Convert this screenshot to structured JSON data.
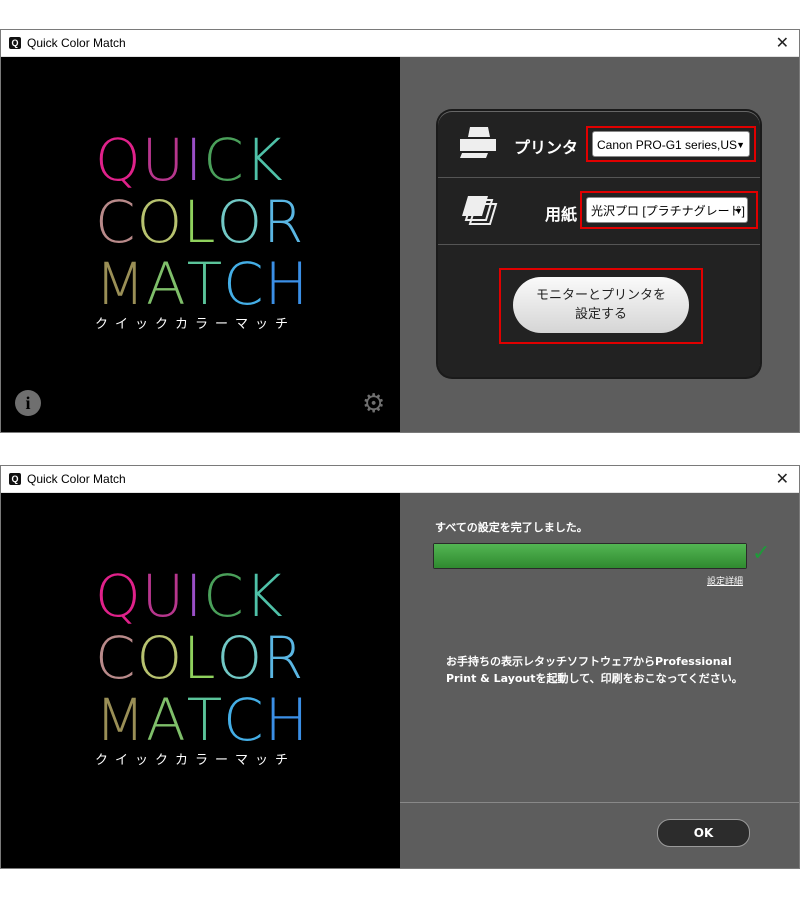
{
  "window1": {
    "title": "Quick Color Match",
    "app_icon": "Q",
    "logo": {
      "line1": [
        "Q",
        "U",
        "I",
        "C",
        "K"
      ],
      "line2": [
        "C",
        "O",
        "L",
        "O",
        "R"
      ],
      "line3": [
        "M",
        "A",
        "T",
        "C",
        "H"
      ],
      "subtitle": "クイックカラーマッチ",
      "colors": {
        "line1": [
          "#e0218a",
          "#b7368d",
          "#9a4fc6",
          "#4aa05a",
          "#4fc1a8"
        ],
        "line2": [
          "#b98a8a",
          "#b7c26f",
          "#8fd15d",
          "#71c8c5",
          "#5ab6e3"
        ],
        "line3": [
          "#9a8f56",
          "#7fbf6a",
          "#5bc49a",
          "#44aee6",
          "#3b8fe6"
        ]
      }
    },
    "printer_label": "プリンタ",
    "printer_value": "Canon PRO-G1 series,US",
    "paper_label": "用紙",
    "paper_value": "光沢プロ [プラチナグレード]",
    "setup_button": [
      "モニターとプリンタを",
      "設定する"
    ],
    "printer_icon": "printer-icon",
    "paper_icon": "paper-stack-icon",
    "info_icon": "i",
    "settings_icon": "⚙"
  },
  "window2": {
    "title": "Quick Color Match",
    "app_icon": "Q",
    "complete_text": "すべての設定を完了しました。",
    "progress": 1.0,
    "check": "✓",
    "detail_link": "設定詳細",
    "message": [
      "お手持ちの表示レタッチソフトウェアからProfessional",
      "Print & Layoutを起動して、印刷をおこなってください。"
    ],
    "ok_label": "OK"
  },
  "close_glyph": "✕",
  "accent_red": "#e00000",
  "progress_green": "#3fa33f"
}
